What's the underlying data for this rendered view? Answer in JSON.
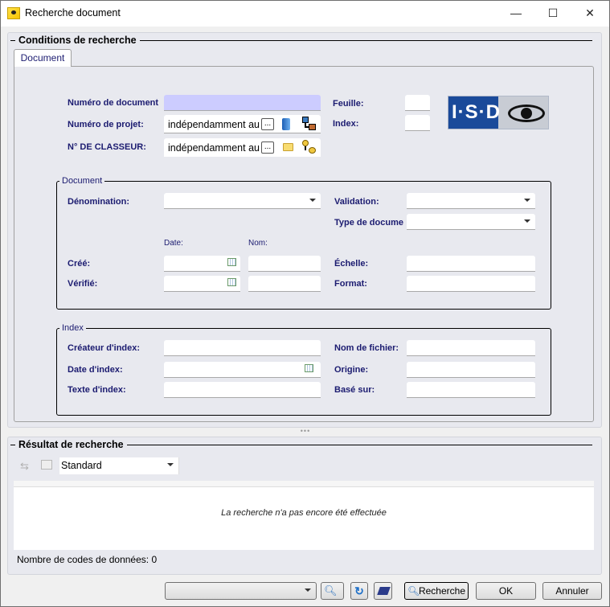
{
  "window": {
    "title": "Recherche document",
    "minimize": "—",
    "maximize": "☐",
    "close": "✕"
  },
  "conditions": {
    "header": "Conditions de recherche",
    "tab": "Document",
    "doc_number": {
      "label": "Numéro de document",
      "value": ""
    },
    "project_number": {
      "label": "Numéro de projet:",
      "value": "indépendamment au"
    },
    "binder_number": {
      "label": "N° DE CLASSEUR:",
      "value": "indépendamment au"
    },
    "sheet": {
      "label": "Feuille:",
      "value": ""
    },
    "index": {
      "label": "Index:",
      "value": ""
    },
    "ellipsis": "...",
    "logo_text": "I·S·D",
    "document_group": {
      "legend": "Document",
      "denomination": "Dénomination:",
      "validation": "Validation:",
      "doc_type": "Type de docume",
      "date_header": "Date:",
      "name_header": "Nom:",
      "created": "Créé:",
      "checked": "Vérifié:",
      "scale": "Échelle:",
      "format": "Format:"
    },
    "index_group": {
      "legend": "Index",
      "creator": "Créateur d'index:",
      "date": "Date d'index:",
      "text": "Texte d'index:",
      "filename": "Nom de fichier:",
      "origin": "Origine:",
      "based_on": "Basé sur:"
    }
  },
  "results": {
    "header": "Résultat de recherche",
    "view_select": "Standard",
    "empty_message": "La recherche n'a pas encore été effectuée",
    "count_label": "Nombre de codes de données: 0"
  },
  "footer": {
    "search": "Recherche",
    "ok": "OK",
    "cancel": "Annuler"
  },
  "colors": {
    "label": "#1b1b70",
    "doc_number_field": "#ccccff",
    "panel": "#e8e9ef"
  }
}
